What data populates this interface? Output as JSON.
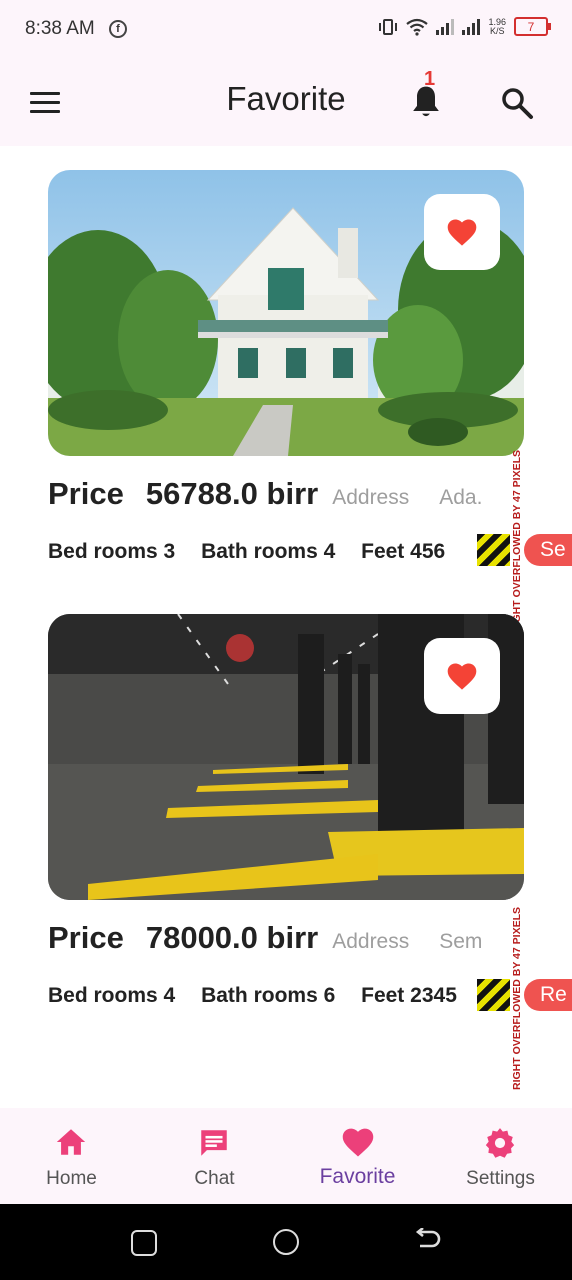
{
  "status_bar": {
    "time": "8:38 AM",
    "notification_icon": "f",
    "net_speed": "1.96",
    "net_unit": "K/S",
    "battery": "7"
  },
  "app_bar": {
    "title": "Favorite",
    "notification_count": "1"
  },
  "listings": [
    {
      "price_label": "Price",
      "price_value": "56788.0 birr",
      "address_label": "Address",
      "address_value": "Ada.",
      "bedrooms_label": "Bed rooms",
      "bedrooms": "3",
      "bathrooms_label": "Bath rooms",
      "bathrooms": "4",
      "feet_label": "Feet",
      "feet": "456",
      "action": "Se",
      "overflow_text": "RIGHT OVERFLOWED BY 47 PIXELS",
      "favorited": true,
      "image": "house-photo"
    },
    {
      "price_label": "Price",
      "price_value": "78000.0 birr",
      "address_label": "Address",
      "address_value": "Sem",
      "bedrooms_label": "Bed rooms",
      "bedrooms": "4",
      "bathrooms_label": "Bath rooms",
      "bathrooms": "6",
      "feet_label": "Feet",
      "feet": "2345",
      "action": "Re",
      "overflow_text": "RIGHT OVERFLOWED BY 47 PIXELS",
      "favorited": true,
      "image": "parking-photo"
    }
  ],
  "bottom_nav": [
    {
      "label": "Home",
      "icon": "home-icon",
      "active": false
    },
    {
      "label": "Chat",
      "icon": "chat-icon",
      "active": false
    },
    {
      "label": "Favorite",
      "icon": "heart-icon",
      "active": true
    },
    {
      "label": "Settings",
      "icon": "gear-icon",
      "active": false
    }
  ],
  "colors": {
    "accent": "#ec407a",
    "active_label": "#6b3fa0",
    "favorite_heart": "#f44336",
    "overflow_pill": "#ef5350"
  }
}
